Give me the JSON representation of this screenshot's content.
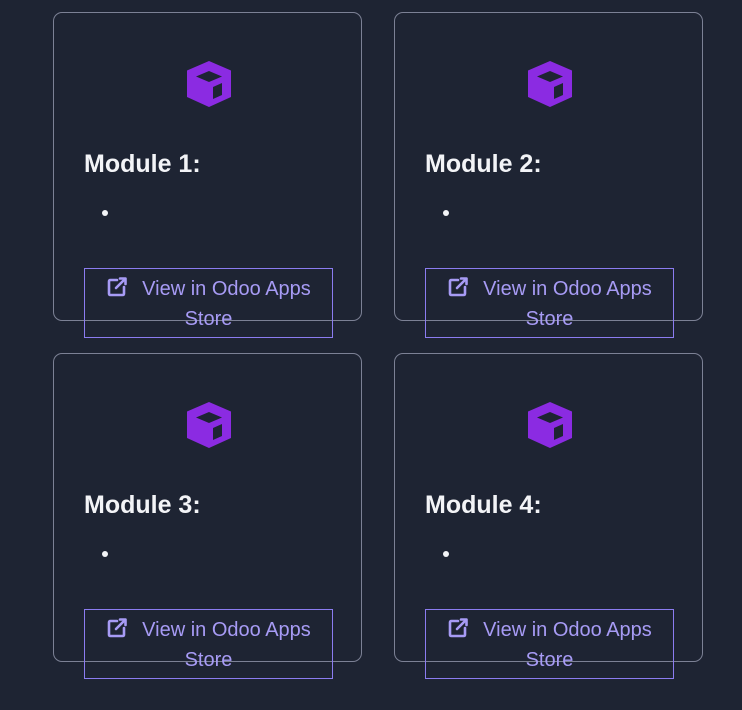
{
  "colors": {
    "background": "#1e2433",
    "card_border": "#7c8195",
    "accent_purple": "#8b2be2",
    "button_text": "#a79bf5",
    "title_text": "#f3f4f7"
  },
  "icons": {
    "module": "cube-icon",
    "store_link": "external-link-icon"
  },
  "modules": [
    {
      "title": "Module 1:",
      "button_label": "View in Odoo Apps Store"
    },
    {
      "title": "Module 2:",
      "button_label": "View in Odoo Apps Store"
    },
    {
      "title": "Module 3:",
      "button_label": "View in Odoo Apps Store"
    },
    {
      "title": "Module 4:",
      "button_label": "View in Odoo Apps Store"
    }
  ]
}
